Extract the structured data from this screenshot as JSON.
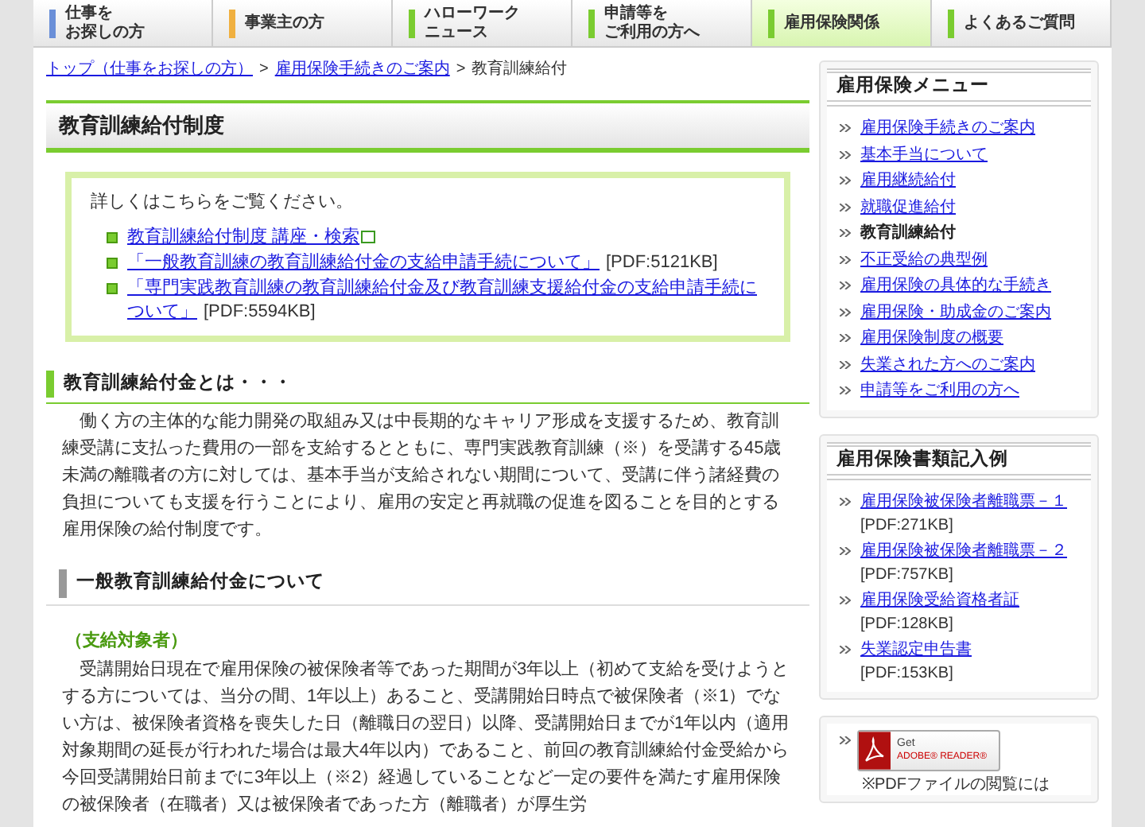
{
  "nav": {
    "tabs": [
      {
        "lines": [
          "仕事を",
          "お探しの方"
        ],
        "color": "#6a8fd8",
        "selected": false
      },
      {
        "lines": [
          "事業主の方"
        ],
        "color": "#f0b040",
        "selected": false
      },
      {
        "lines": [
          "ハローワーク",
          "ニュース"
        ],
        "color": "#7acc30",
        "selected": false
      },
      {
        "lines": [
          "申請等を",
          "ご利用の方へ"
        ],
        "color": "#7acc30",
        "selected": false
      },
      {
        "lines": [
          "雇用保険関係"
        ],
        "color": "#7acc30",
        "selected": true
      },
      {
        "lines": [
          "よくあるご質問"
        ],
        "color": "#7acc30",
        "selected": false
      }
    ]
  },
  "breadcrumb": {
    "separator": ">",
    "items": [
      {
        "label": "トップ（仕事をお探しの方）",
        "link": true
      },
      {
        "label": "雇用保険手続きのご案内",
        "link": true
      },
      {
        "label": "教育訓練給付",
        "link": false
      }
    ]
  },
  "page_title": "教育訓練給付制度",
  "info_box": {
    "intro": "詳しくはこちらをご覧ください。",
    "links": [
      {
        "label": "教育訓練給付制度 講座・検索",
        "external": true
      },
      {
        "label": "「一般教育訓練の教育訓練給付金の支給申請手続について」",
        "size": "[PDF:5121KB]",
        "external": false
      },
      {
        "label": "「専門実践教育訓練の教育訓練給付金及び教育訓練支援給付金の支給申請手続について」",
        "size": "[PDF:5594KB]",
        "external": false
      }
    ]
  },
  "section": {
    "heading": "教育訓練給付金とは・・・",
    "paragraph": "働く方の主体的な能力開発の取組み又は中長期的なキャリア形成を支援するため、教育訓練受講に支払った費用の一部を支給するとともに、専門実践教育訓練（※）を受講する45歳未満の離職者の方に対しては、基本手当が支給されない期間について、受講に伴う諸経費の負担についても支援を行うことにより、雇用の安定と再就職の促進を図ることを目的とする雇用保険の給付制度です。"
  },
  "subsection": {
    "heading": "一般教育訓練給付金について",
    "label": "（支給対象者）",
    "paragraph": "受講開始日現在で雇用保険の被保険者等であった期間が3年以上（初めて支給を受けようとする方については、当分の間、1年以上）あること、受講開始日時点で被保険者（※1）でない方は、被保険者資格を喪失した日（離職日の翌日）以降、受講開始日までが1年以内（適用対象期間の延長が行われた場合は最大4年以内）であること、前回の教育訓練給付金受給から今回受講開始日前までに3年以上（※2）経過していることなど一定の要件を満たす雇用保険の被保険者（在職者）又は被保険者であった方（離職者）が厚生労"
  },
  "sidebar": {
    "menu": {
      "title": "雇用保険メニュー",
      "items": [
        {
          "label": "雇用保険手続きのご案内",
          "selected": false
        },
        {
          "label": "基本手当について",
          "selected": false
        },
        {
          "label": "雇用継続給付",
          "selected": false
        },
        {
          "label": "就職促進給付",
          "selected": false
        },
        {
          "label": "教育訓練給付",
          "selected": true
        },
        {
          "label": "不正受給の典型例",
          "selected": false
        },
        {
          "label": "雇用保険の具体的な手続き",
          "selected": false
        },
        {
          "label": "雇用保険・助成金のご案内",
          "selected": false
        },
        {
          "label": "雇用保険制度の概要",
          "selected": false
        },
        {
          "label": "失業された方へのご案内",
          "selected": false
        },
        {
          "label": "申請等をご利用の方へ",
          "selected": false
        }
      ]
    },
    "forms": {
      "title": "雇用保険書類記入例",
      "items": [
        {
          "label": "雇用保険被保険者離職票－１",
          "size": "[PDF:271KB]"
        },
        {
          "label": "雇用保険被保険者離職票－２",
          "size": "[PDF:757KB]"
        },
        {
          "label": "雇用保険受給資格者証",
          "size": "[PDF:128KB]"
        },
        {
          "label": "失業認定申告書",
          "size": "[PDF:153KB]"
        }
      ]
    },
    "adobe": {
      "badge_top": "Get",
      "badge_brand": "ADOBE® READER®",
      "note": "※PDFファイルの閲覧には"
    }
  }
}
